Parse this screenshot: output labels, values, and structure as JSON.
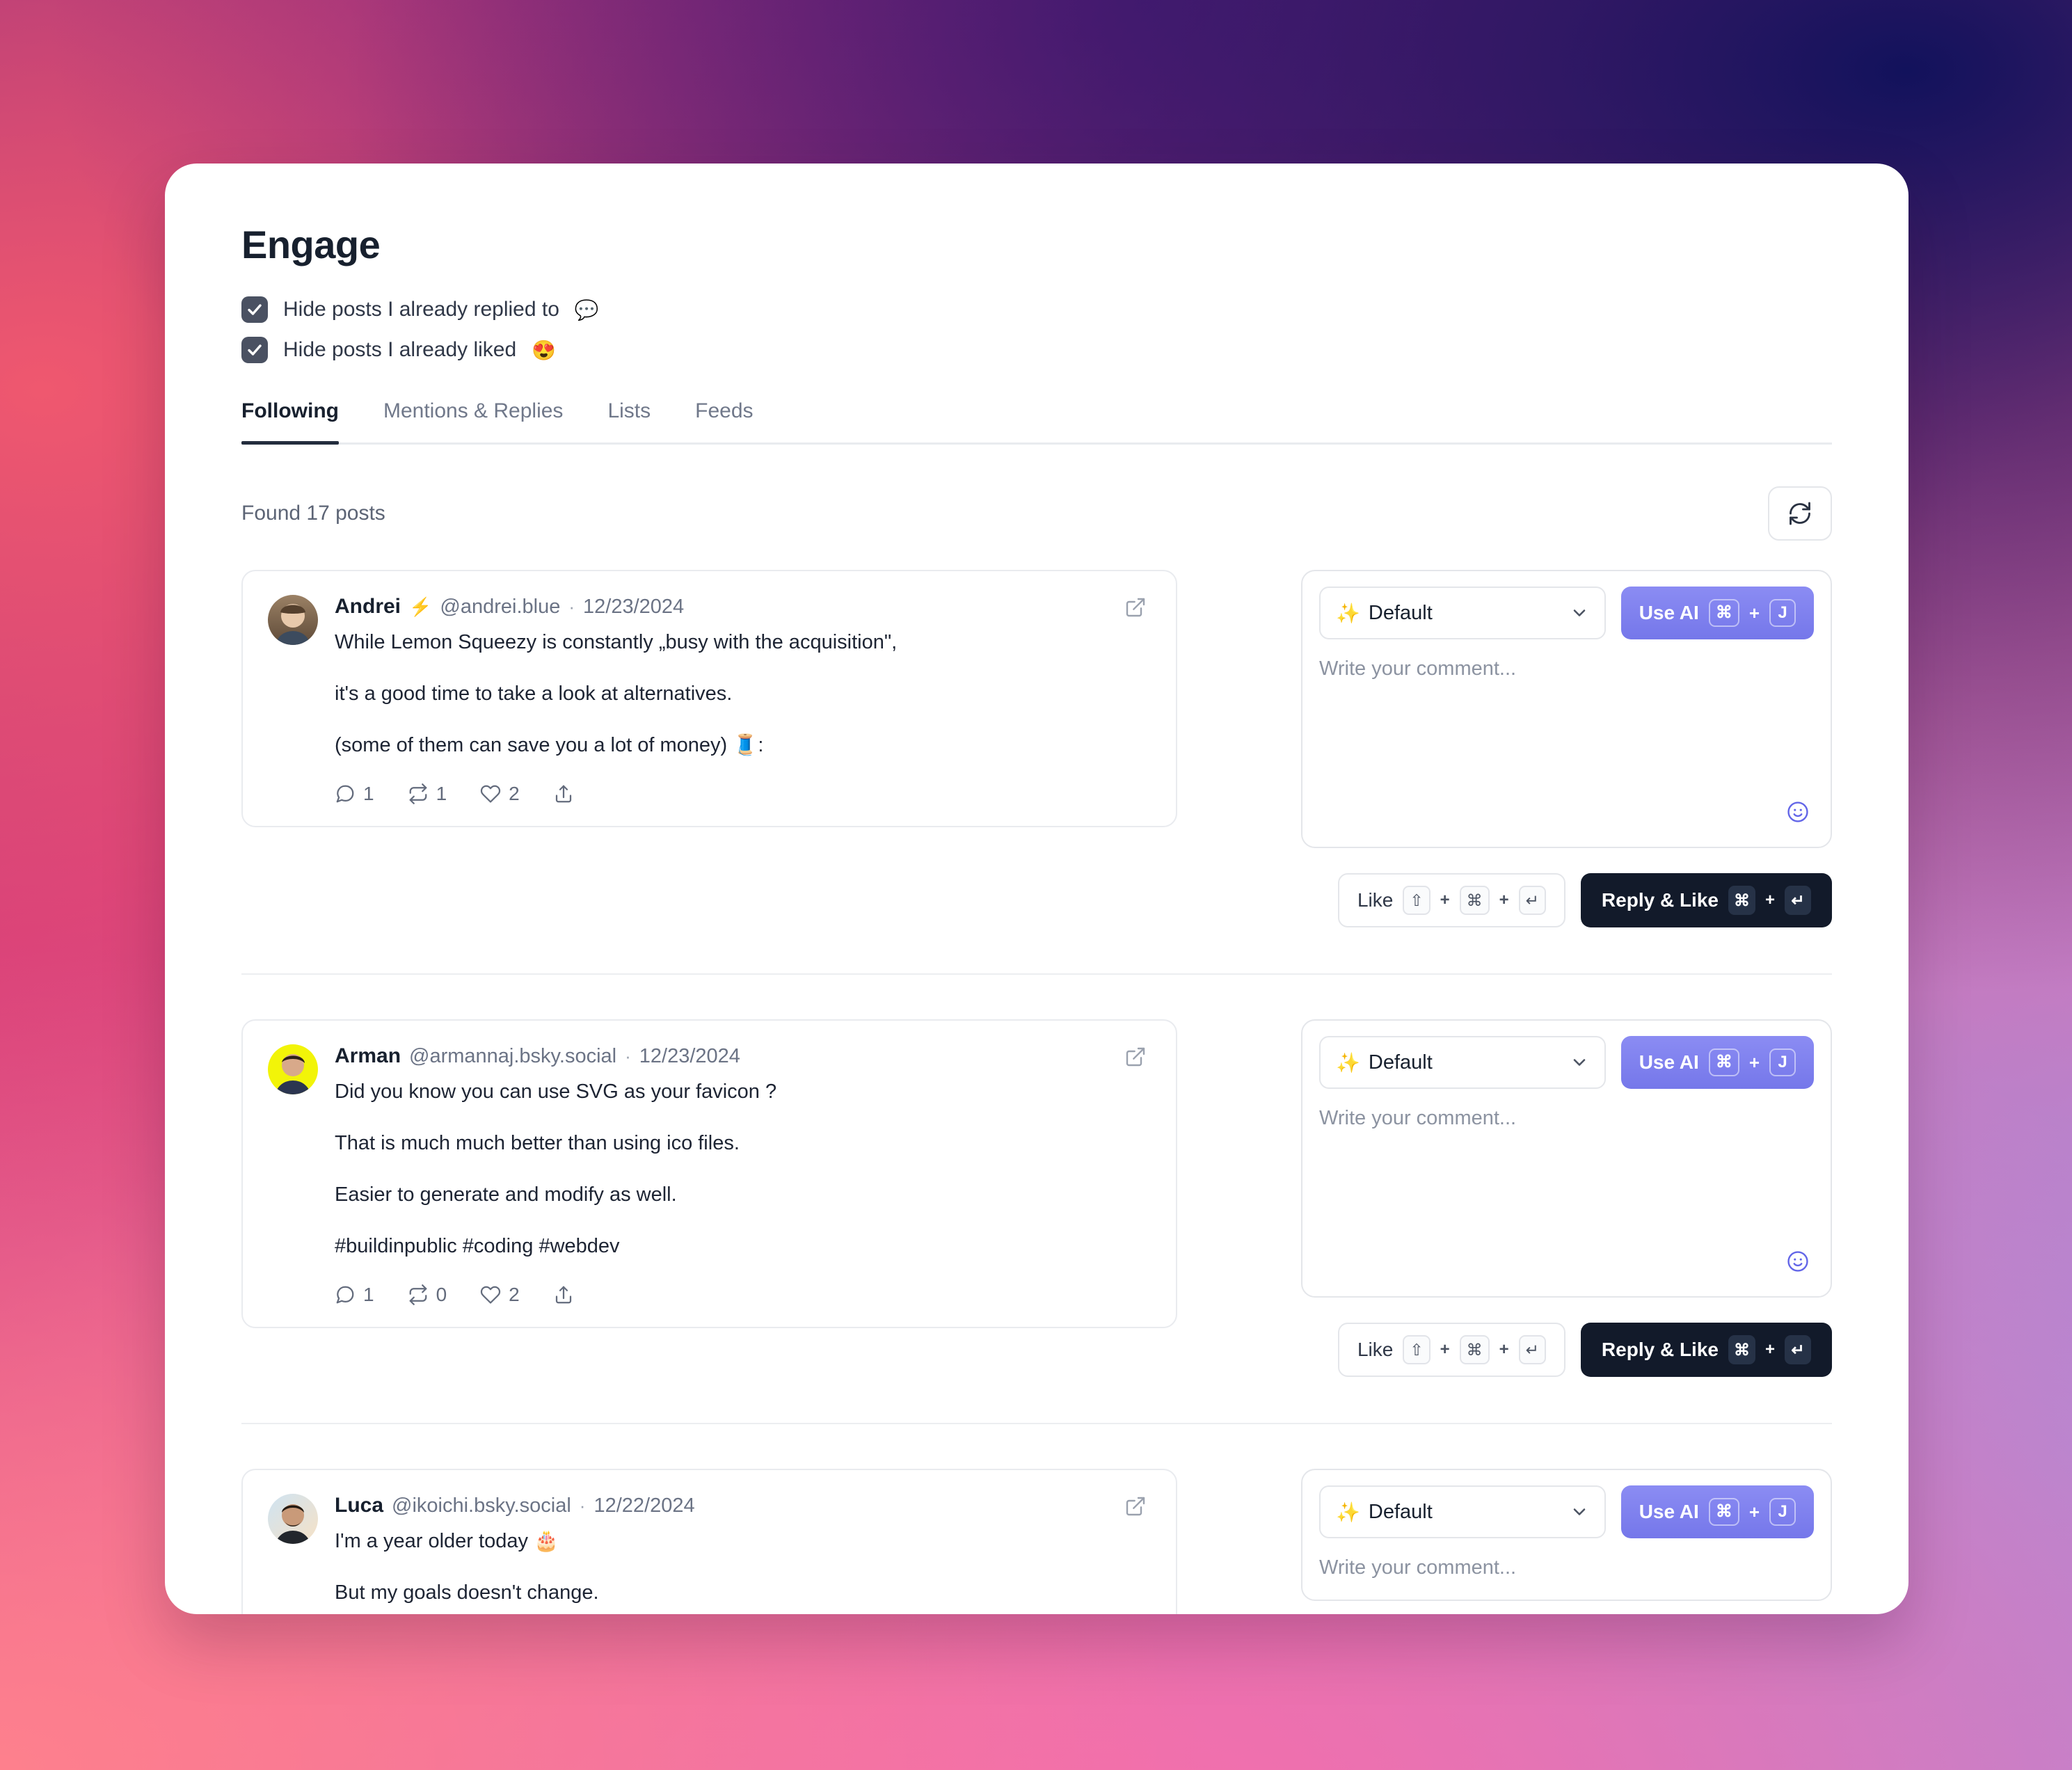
{
  "page": {
    "title": "Engage"
  },
  "filters": [
    {
      "label": "Hide posts I already replied to",
      "emoji": "💬",
      "checked": true,
      "name": "hide-replied"
    },
    {
      "label": "Hide posts I already liked",
      "emoji": "😍",
      "checked": true,
      "name": "hide-liked"
    }
  ],
  "tabs": [
    {
      "label": "Following",
      "active": true
    },
    {
      "label": "Mentions & Replies",
      "active": false
    },
    {
      "label": "Lists",
      "active": false
    },
    {
      "label": "Feeds",
      "active": false
    }
  ],
  "results": {
    "found_text": "Found 17 posts",
    "count": 17,
    "refresh_icon": "refresh-icon"
  },
  "composer_defaults": {
    "preset_emoji": "✨",
    "preset_label": "Default",
    "use_ai_label": "Use AI",
    "use_ai_keys": [
      "⌘",
      "J"
    ],
    "placeholder": "Write your comment...",
    "like_label": "Like",
    "like_keys": [
      "⇧",
      "⌘",
      "↵"
    ],
    "reply_like_label": "Reply & Like",
    "reply_like_keys": [
      "⌘",
      "↵"
    ],
    "emoji_button": "smiley-icon",
    "chevron": "chevron-down-icon"
  },
  "posts": [
    {
      "author": "Andrei",
      "badge": "⚡",
      "handle": "@andrei.blue",
      "separator": "·",
      "date": "12/23/2024",
      "paragraphs": [
        "While Lemon Squeezy is constantly „busy with the acquisition\",",
        "it's a good time to take a look at alternatives.",
        "(some of them can save you a lot of money) 🧵:"
      ],
      "hashtags": "",
      "stats": {
        "replies": "1",
        "reposts": "1",
        "likes": "2"
      },
      "avatar_from": "#8a6b52",
      "avatar_to": "#d7c4ae"
    },
    {
      "author": "Arman",
      "badge": "",
      "handle": "@armannaj.bsky.social",
      "separator": "·",
      "date": "12/23/2024",
      "paragraphs": [
        "Did you know you can use SVG as your favicon ?",
        "That is much much better than using ico files.",
        "Easier to generate and modify as well."
      ],
      "hashtags": "#buildinpublic #coding #webdev",
      "stats": {
        "replies": "1",
        "reposts": "0",
        "likes": "2"
      },
      "avatar_from": "#f2f408",
      "avatar_to": "#e8ea00"
    },
    {
      "author": "Luca",
      "badge": "",
      "handle": "@ikoichi.bsky.social",
      "separator": "·",
      "date": "12/22/2024",
      "paragraphs": [
        "I'm a year older today 🎂",
        "But my goals doesn't change."
      ],
      "hashtags": "",
      "stats": {
        "replies": "",
        "reposts": "",
        "likes": ""
      },
      "avatar_from": "#cfe3f2",
      "avatar_to": "#f3dfc8"
    }
  ]
}
